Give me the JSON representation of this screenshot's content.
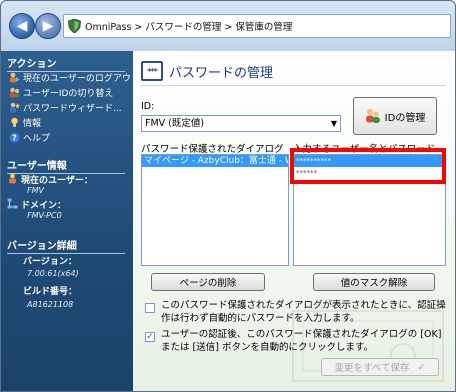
{
  "address": {
    "crumbs": "OmniPass > パスワードの管理 > 保管庫の管理"
  },
  "sidebar": {
    "actions_title": "アクション",
    "actions": [
      {
        "label": "現在のユーザーのログアウト",
        "icon": "user-logout-icon"
      },
      {
        "label": "ユーザーIDの切り替え",
        "icon": "switch-user-icon"
      },
      {
        "label": "パスワードウィザード...",
        "icon": "password-wizard-icon"
      },
      {
        "label": "情報",
        "icon": "info-bulb-icon"
      },
      {
        "label": "ヘルプ",
        "icon": "help-icon"
      }
    ],
    "user_info_title": "ユーザー情報",
    "current_user_label": "現在のユーザー：",
    "current_user_value": "FMV",
    "domain_label": "ドメイン：",
    "domain_value": "FMV-PC0",
    "version_title": "バージョン詳細",
    "version_label": "バージョン：",
    "version_value": "7.00.61(x64)",
    "build_label": "ビルド番号：",
    "build_value": "A81621108"
  },
  "main": {
    "title": "パスワードの管理",
    "id_label": "ID:",
    "id_selected": "FMV (既定値)",
    "id_button": "IDの管理",
    "dialogs_label": "パスワード保護されたダイアログ",
    "inputs_label": "入力するユーザー名とパスワード",
    "dialog_rows": [
      "マイページ - AzbyClub：富士通 - Windows Internet Explorer"
    ],
    "input_rows": [
      "**********",
      "******"
    ],
    "delete_button": "ページの削除",
    "unmask_button": "値のマスク解除",
    "option1": "このパスワード保護されたダイアログが表示されたときに、認証操作は行わず自動的にパスワードを入力します。",
    "option2": "ユーザーの認証後、このパスワード保護されたダイアログの [OK] または [送信] ボタンを自動的にクリックします。",
    "save_button": "変更をすべて保存",
    "save_check": "✓"
  },
  "colors": {
    "sidebar": "#1f4a75",
    "highlight": "#ff0000",
    "selection": "#3399ff"
  }
}
